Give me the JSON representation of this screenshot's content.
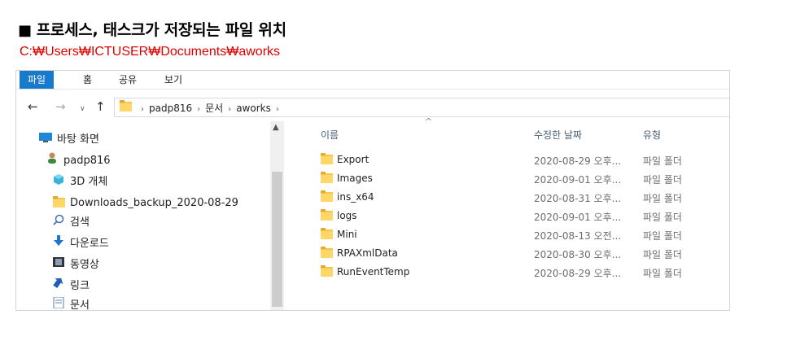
{
  "heading": {
    "bullet": "■",
    "text": "프로세스, 태스크가 저장되는 파일 위치"
  },
  "path_text": "C:₩Users₩ICTUSER₩Documents₩aworks",
  "ribbon": {
    "tabs": [
      "파일",
      "홈",
      "공유",
      "보기"
    ]
  },
  "address": {
    "crumbs": [
      "padp816",
      "문서",
      "aworks"
    ]
  },
  "nav": {
    "items": [
      {
        "label": "바탕 화면",
        "icon": "desktop-icon"
      },
      {
        "label": "padp816",
        "icon": "user-icon"
      },
      {
        "label": "3D 개체",
        "icon": "3d-objects-icon"
      },
      {
        "label": "Downloads_backup_2020-08-29",
        "icon": "folder-icon"
      },
      {
        "label": "검색",
        "icon": "search-icon"
      },
      {
        "label": "다운로드",
        "icon": "download-icon"
      },
      {
        "label": "동영상",
        "icon": "video-icon"
      },
      {
        "label": "링크",
        "icon": "link-icon"
      },
      {
        "label": "문서",
        "icon": "document-icon"
      }
    ]
  },
  "columns": {
    "name": "이름",
    "modified": "수정한 날짜",
    "type": "유형"
  },
  "files": [
    {
      "name": "Export",
      "modified": "2020-08-29 오후...",
      "type": "파일 폴더"
    },
    {
      "name": "Images",
      "modified": "2020-09-01 오후...",
      "type": "파일 폴더"
    },
    {
      "name": "ins_x64",
      "modified": "2020-08-31 오후...",
      "type": "파일 폴더"
    },
    {
      "name": "logs",
      "modified": "2020-09-01 오후...",
      "type": "파일 폴더"
    },
    {
      "name": "Mini",
      "modified": "2020-08-13 오전...",
      "type": "파일 폴더"
    },
    {
      "name": "RPAXmlData",
      "modified": "2020-08-30 오후...",
      "type": "파일 폴더"
    },
    {
      "name": "RunEventTemp",
      "modified": "2020-08-29 오후...",
      "type": "파일 폴더"
    }
  ],
  "colors": {
    "accent": "#1979ca",
    "path_red": "#e00000",
    "folder": "#ffd767"
  }
}
